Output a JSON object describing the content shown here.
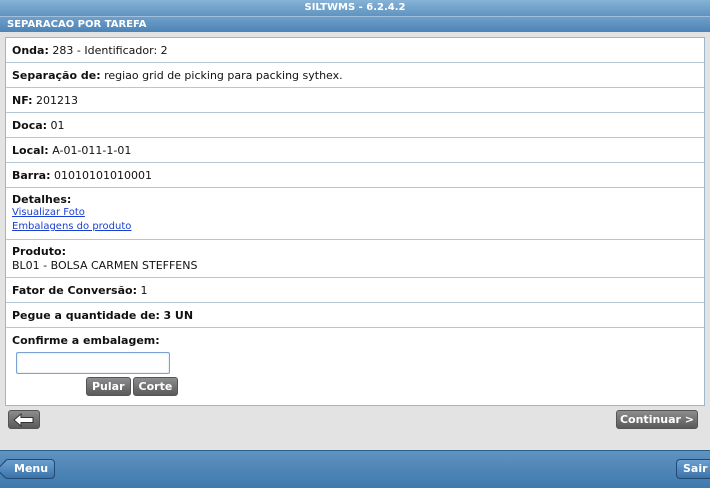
{
  "app": {
    "title": "SILTWMS - 6.2.4.2"
  },
  "header": {
    "title": "SEPARACAO POR TAREFA"
  },
  "fields": {
    "onda": {
      "label": "Onda:",
      "value": "283 - Identificador: 2"
    },
    "separacao": {
      "label": "Separação de:",
      "value": "regiao grid de picking para packing sythex."
    },
    "nf": {
      "label": "NF:",
      "value": "201213"
    },
    "doca": {
      "label": "Doca:",
      "value": "01"
    },
    "local": {
      "label": "Local:",
      "value": "A-01-011-1-01"
    },
    "barra": {
      "label": "Barra:",
      "value": "01010101010001"
    },
    "detalhes": {
      "label": "Detalhes:",
      "links": [
        "Visualizar Foto",
        "Embalagens do produto"
      ]
    },
    "produto": {
      "label": "Produto:",
      "value": "BL01 - BOLSA CARMEN STEFFENS"
    },
    "fator": {
      "label": "Fator de Conversão:",
      "value": "1"
    },
    "pegue": {
      "label": "Pegue a quantidade de:",
      "value": "3 UN"
    },
    "confirme": {
      "label": "Confirme a embalagem:",
      "input_value": "",
      "placeholder": ""
    }
  },
  "buttons": {
    "pular": "Pular",
    "corte": "Corte",
    "continuar": "Continuar >"
  },
  "footer": {
    "menu": "Menu",
    "sair": "Sair"
  },
  "icons": {
    "back": "arrow-left-icon"
  },
  "colors": {
    "bar_blue": "#5f93c0",
    "link": "#1a3fd1",
    "button_gray": "#6e6e6e"
  }
}
